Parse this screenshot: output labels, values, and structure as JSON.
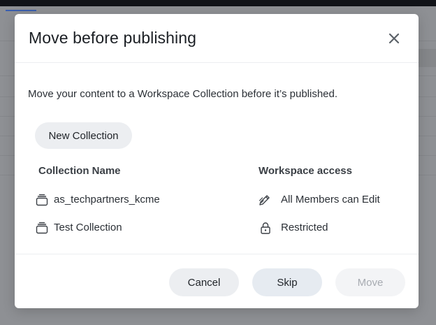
{
  "dialog": {
    "title": "Move before publishing",
    "description": "Move your content to a Workspace Collection before it’s published.",
    "new_collection_label": "New Collection",
    "columns": {
      "name": "Collection Name",
      "access": "Workspace access"
    },
    "collections": [
      {
        "name": "as_techpartners_kcme",
        "icon": "collection-stack-icon",
        "access": "All Members can Edit",
        "access_icon": "pencil-edit-icon"
      },
      {
        "name": "Test Collection",
        "icon": "collection-stack-icon",
        "access": "Restricted",
        "access_icon": "lock-icon"
      }
    ],
    "footer": {
      "cancel_label": "Cancel",
      "skip_label": "Skip",
      "move_label": "Move"
    }
  },
  "colors": {
    "button_bg": "#eceef1",
    "disabled_text": "#a7abb1",
    "overlay": "#8e9094"
  }
}
